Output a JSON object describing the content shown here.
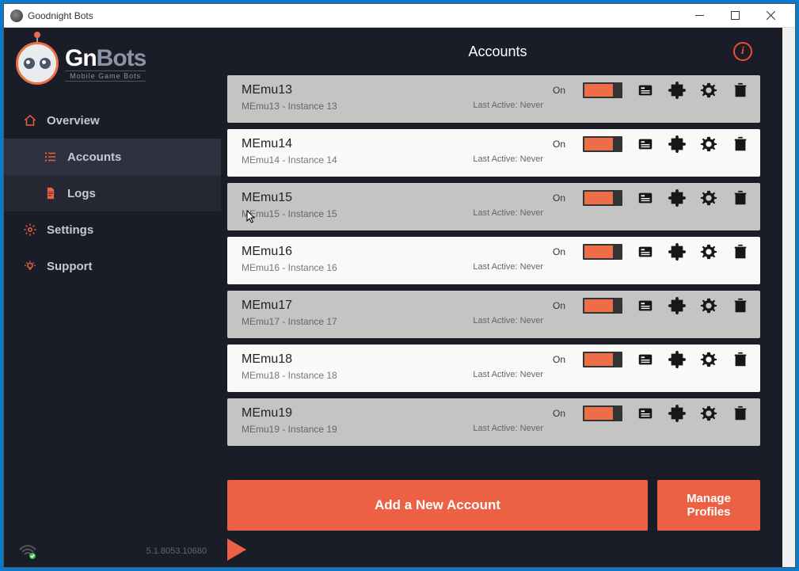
{
  "window": {
    "title": "Goodnight Bots"
  },
  "logo": {
    "brand_g": "Gn",
    "brand_rest": "Bots",
    "tagline": "Mobile Game Bots"
  },
  "nav": {
    "overview": "Overview",
    "accounts": "Accounts",
    "logs": "Logs",
    "settings": "Settings",
    "support": "Support"
  },
  "footer": {
    "version": "5.1.8053.10680"
  },
  "header": {
    "title": "Accounts"
  },
  "labels": {
    "on": "On",
    "last_active_prefix": "Last Active: ",
    "never": "Never",
    "add_account": "Add a New Account",
    "manage_profiles": "Manage Profiles"
  },
  "accounts": [
    {
      "name": "MEmu13",
      "instance": "MEmu13 - Instance 13",
      "last_active": "Last Active: Never",
      "shade": "grey"
    },
    {
      "name": "MEmu14",
      "instance": "MEmu14 - Instance 14",
      "last_active": "Last Active: Never",
      "shade": "light"
    },
    {
      "name": "MEmu15",
      "instance": "MEmu15 - Instance 15",
      "last_active": "Last Active: Never",
      "shade": "grey"
    },
    {
      "name": "MEmu16",
      "instance": "MEmu16 - Instance 16",
      "last_active": "Last Active: Never",
      "shade": "light"
    },
    {
      "name": "MEmu17",
      "instance": "MEmu17 - Instance 17",
      "last_active": "Last Active: Never",
      "shade": "grey"
    },
    {
      "name": "MEmu18",
      "instance": "MEmu18 - Instance 18",
      "last_active": "Last Active: Never",
      "shade": "light"
    },
    {
      "name": "MEmu19",
      "instance": "MEmu19 - Instance 19",
      "last_active": "Last Active: Never",
      "shade": "grey"
    }
  ],
  "colors": {
    "accent": "#ec6043",
    "dark": "#1a1d27",
    "darker": "#252833"
  }
}
